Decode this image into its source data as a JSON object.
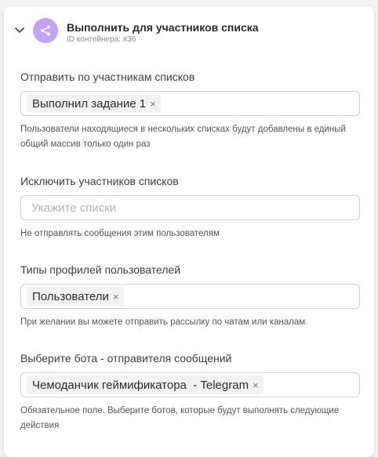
{
  "header": {
    "title": "Выполнить для участников списка",
    "subtitle": "ID контейнера: #36",
    "accent_color": "#c1a2f4",
    "icon": "share-nodes-icon"
  },
  "fields": [
    {
      "label": "Отправить по участникам списков",
      "tags": [
        "Выполнил задание 1"
      ],
      "help": "Пользователи находящиеся в нескольких списках будут добавлены в единый общий массив только один раз"
    },
    {
      "label": "Исключить участников списков",
      "placeholder": "Укажите списки",
      "help": "Не отправлять сообщения этим пользователям"
    },
    {
      "label": "Типы профилей пользователей",
      "tags": [
        "Пользователи"
      ],
      "help": "При желании вы можете отправить рассылку по чатам или каналам"
    },
    {
      "label": "Выберите бота - отправителя сообщений",
      "tags": [
        "Чемоданчик геймификатора  - Telegram"
      ],
      "help": "Обязательное поле. Выберите ботов, которые будут выполнять следующие действия"
    }
  ],
  "remove_glyph": "×"
}
